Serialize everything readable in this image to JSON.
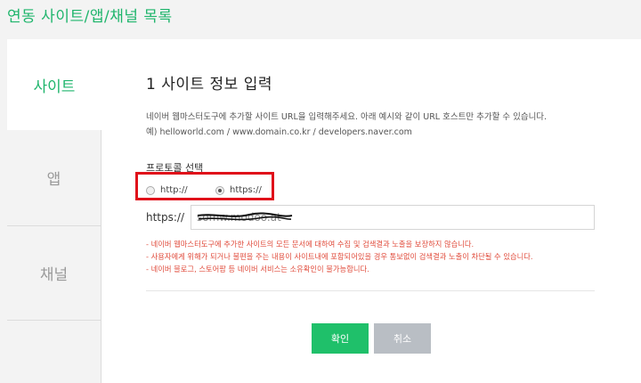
{
  "page_title": "연동 사이트/앱/채널 목록",
  "tabs": [
    {
      "label": "사이트",
      "active": true
    },
    {
      "label": "앱",
      "active": false
    },
    {
      "label": "채널",
      "active": false
    }
  ],
  "section": {
    "title": "1 사이트 정보 입력",
    "description_1": "네이버 웹마스터도구에 추가할 사이트 URL을 입력해주세요. 아래 예시와 같이 URL 호스트만 추가할 수 있습니다.",
    "description_2": "예) helloworld.com / www.domain.co.kr / developers.naver.com"
  },
  "protocol": {
    "label": "프로토콜 선택",
    "options": [
      {
        "label": "http://",
        "checked": false
      },
      {
        "label": "https://",
        "checked": true
      }
    ]
  },
  "url_input": {
    "prefix": "https://",
    "value": "somw.modoo.at"
  },
  "notes": [
    "- 네이버 웹마스터도구에 추가한 사이트의 모든 문서에 대하여 수집 및 검색결과 노출을 보장하지 않습니다.",
    "- 사용자에게 위해가 되거나 불편을 주는 내용이 사이트내에 포함되어있을 경우 통보없이 검색결과 노출이 차단될 수 있습니다.",
    "- 네이버 블로그, 스토어팜 등 네이버 서비스는 소유확인이 불가능합니다."
  ],
  "buttons": {
    "confirm": "확인",
    "cancel": "취소"
  },
  "colors": {
    "accent": "#1fb56c",
    "confirm_button": "#1fc06a",
    "cancel_button": "#b9bec4",
    "highlight": "#e0101a",
    "notice_text": "#e04a3a"
  }
}
